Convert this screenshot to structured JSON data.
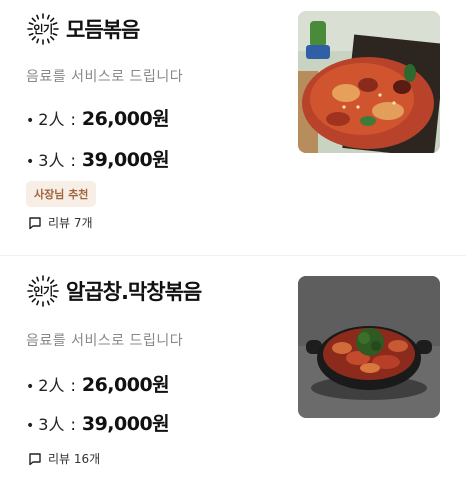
{
  "menu": [
    {
      "badge": "인기",
      "name": "모듬볶음",
      "description": "음료를 서비스로 드립니다",
      "prices": [
        {
          "size": "2人",
          "price": "26,000원"
        },
        {
          "size": "3人",
          "price": "39,000원"
        }
      ],
      "tag": "사장님 추천",
      "reviews": "리뷰 7개"
    },
    {
      "badge": "인기",
      "name": "알곱창.막창볶음",
      "description": "음료를 서비스로 드립니다",
      "prices": [
        {
          "size": "2人",
          "price": "26,000원"
        },
        {
          "size": "3人",
          "price": "39,000원"
        }
      ],
      "reviews": "리뷰 16개"
    }
  ],
  "colors": {
    "tag_bg": "#f7eee6",
    "tag_text": "#a0653b",
    "desc": "#888888"
  }
}
